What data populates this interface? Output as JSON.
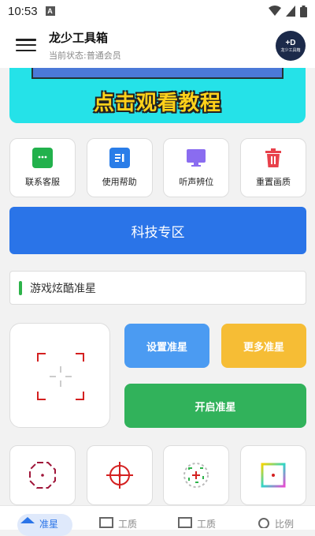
{
  "status_bar": {
    "time": "10:53",
    "notification_icon": "a-icon",
    "wifi_icon": "wifi-icon",
    "battery_icon": "battery-icon"
  },
  "app_bar": {
    "title": "龙少工具箱",
    "subtitle": "当前状态:普通会员",
    "menu_icon": "hamburger-menu-icon",
    "avatar_text": "龙少工具箱"
  },
  "banner": {
    "cta": "点击观看教程"
  },
  "quick_actions": [
    {
      "label": "联系客服",
      "icon": "chat-icon",
      "color": "#22b14c"
    },
    {
      "label": "使用帮助",
      "icon": "document-icon",
      "color": "#2a7de8"
    },
    {
      "label": "听声辨位",
      "icon": "monitor-icon",
      "color": "#8a6cf0"
    },
    {
      "label": "重置画质",
      "icon": "trash-icon",
      "color": "#e8414b"
    }
  ],
  "tech_zone_button": "科技专区",
  "game_field": {
    "value": "游戏炫酷准星"
  },
  "buttons": {
    "set_crosshair": "设置准星",
    "more_crosshair": "更多准星",
    "enable_crosshair": "开启准星"
  },
  "crosshair_styles": [
    {
      "icon": "octagon-crosshair-icon"
    },
    {
      "icon": "circle-crosshair-icon"
    },
    {
      "icon": "green-dashed-crosshair-icon"
    },
    {
      "icon": "rainbow-square-crosshair-icon"
    }
  ],
  "bottom_tabs": [
    {
      "label": "准星",
      "icon": "home-icon",
      "active": true
    },
    {
      "label": "工质",
      "icon": "list-icon",
      "active": false
    },
    {
      "label": "工质",
      "icon": "grid-icon",
      "active": false
    },
    {
      "label": "比例",
      "icon": "search-icon",
      "active": false
    }
  ]
}
